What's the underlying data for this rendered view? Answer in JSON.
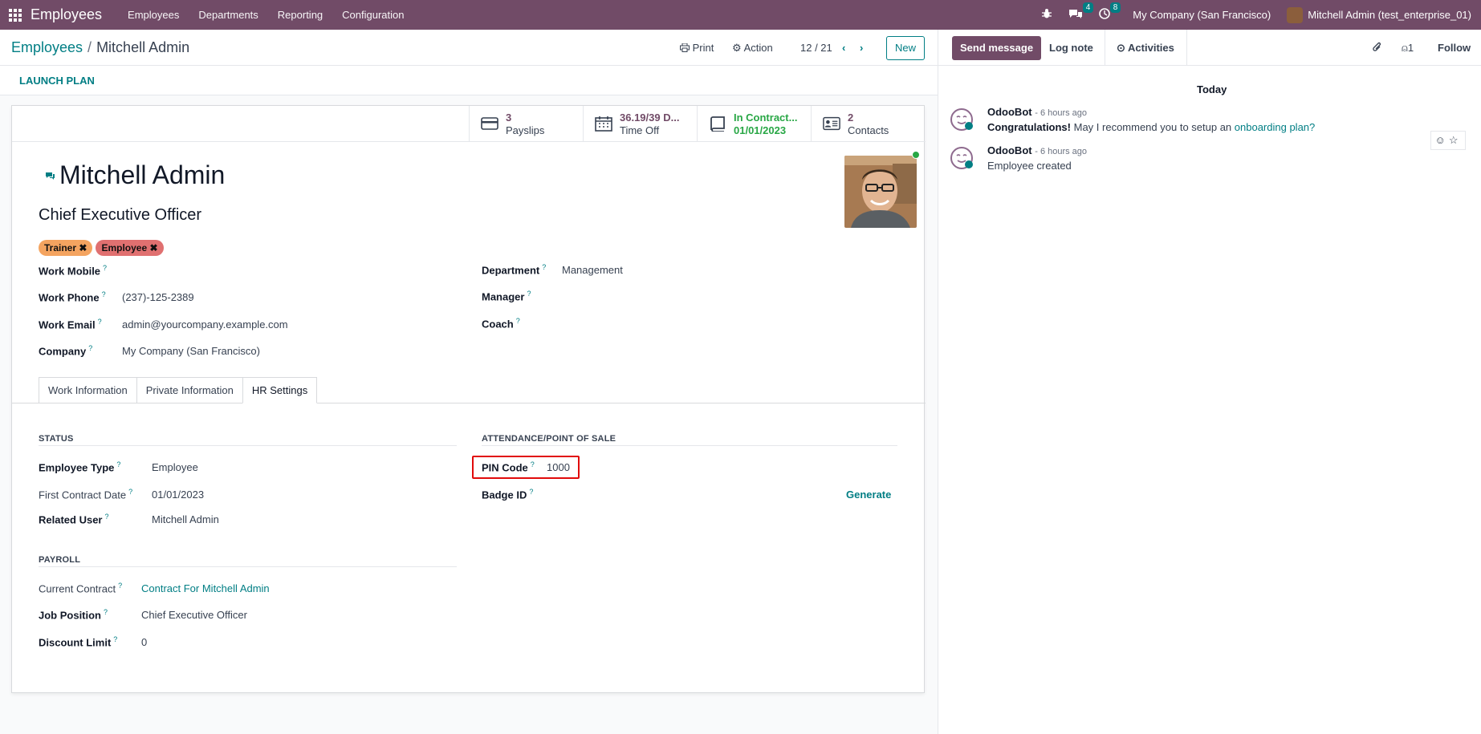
{
  "navbar": {
    "app_name": "Employees",
    "menu": [
      "Employees",
      "Departments",
      "Reporting",
      "Configuration"
    ],
    "messages_count": "4",
    "activities_count": "8",
    "company": "My Company (San Francisco)",
    "user": "Mitchell Admin (test_enterprise_01)"
  },
  "control_panel": {
    "breadcrumb_parent": "Employees",
    "breadcrumb_sep": "/",
    "breadcrumb_current": "Mitchell Admin",
    "print_label": "Print",
    "action_label": "Action",
    "pager": "12 / 21",
    "new_label": "New"
  },
  "status_bar": {
    "launch_plan": "LAUNCH PLAN"
  },
  "smart_buttons": [
    {
      "value": "3",
      "label": "Payslips",
      "icon": "credit-card-icon"
    },
    {
      "value": "36.19/39 D...",
      "label": "Time Off",
      "icon": "calendar-icon"
    },
    {
      "value": "In Contract...",
      "label": "01/01/2023",
      "icon": "book-icon"
    },
    {
      "value": "2",
      "label": "Contacts",
      "icon": "address-card-icon"
    }
  ],
  "employee": {
    "name": "Mitchell Admin",
    "job_title": "Chief Executive Officer",
    "tags": [
      {
        "label": "Trainer",
        "color": "#f4a460"
      },
      {
        "label": "Employee",
        "color": "#e07070"
      }
    ]
  },
  "fields_left": [
    {
      "label": "Work Mobile",
      "value": ""
    },
    {
      "label": "Work Phone",
      "value": "(237)-125-2389"
    },
    {
      "label": "Work Email",
      "value": "admin@yourcompany.example.com"
    },
    {
      "label": "Company",
      "value": "My Company (San Francisco)"
    }
  ],
  "fields_right": [
    {
      "label": "Department",
      "value": "Management"
    },
    {
      "label": "Manager",
      "value": ""
    },
    {
      "label": "Coach",
      "value": ""
    }
  ],
  "tabs": [
    "Work Information",
    "Private Information",
    "HR Settings"
  ],
  "hr_settings": {
    "status_header": "STATUS",
    "employee_type_label": "Employee Type",
    "employee_type": "Employee",
    "first_contract_label": "First Contract Date",
    "first_contract": "01/01/2023",
    "related_user_label": "Related User",
    "related_user": "Mitchell Admin",
    "payroll_header": "PAYROLL",
    "current_contract_label": "Current Contract",
    "current_contract": "Contract For Mitchell Admin",
    "job_position_label": "Job Position",
    "job_position": "Chief Executive Officer",
    "discount_limit_label": "Discount Limit",
    "discount_limit": "0",
    "attendance_header": "ATTENDANCE/POINT OF SALE",
    "pin_label": "PIN Code",
    "pin": "1000",
    "badge_label": "Badge ID",
    "generate_label": "Generate"
  },
  "chatter": {
    "send_message": "Send message",
    "log_note": "Log note",
    "activities": "Activities",
    "followers_count": "1",
    "follow_label": "Follow",
    "today": "Today",
    "messages": [
      {
        "author": "OdooBot",
        "time": "- 6 hours ago",
        "text_bold": "Congratulations!",
        "text": " May I recommend you to setup an ",
        "link": "onboarding plan?"
      },
      {
        "author": "OdooBot",
        "time": "- 6 hours ago",
        "text": "Employee created"
      }
    ]
  },
  "colors": {
    "brand": "#714b67",
    "accent": "#017e84",
    "highlight": "#e10b0b"
  }
}
